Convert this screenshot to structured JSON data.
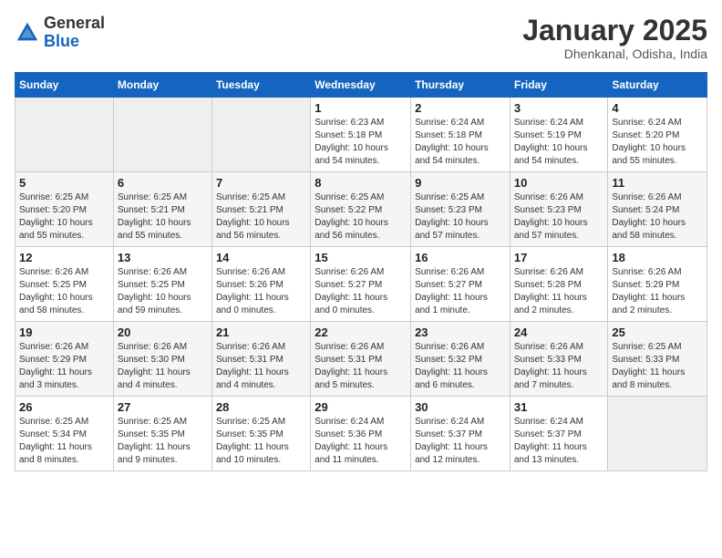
{
  "header": {
    "logo_general": "General",
    "logo_blue": "Blue",
    "month_title": "January 2025",
    "location": "Dhenkanal, Odisha, India"
  },
  "weekdays": [
    "Sunday",
    "Monday",
    "Tuesday",
    "Wednesday",
    "Thursday",
    "Friday",
    "Saturday"
  ],
  "weeks": [
    [
      {
        "day": "",
        "info": ""
      },
      {
        "day": "",
        "info": ""
      },
      {
        "day": "",
        "info": ""
      },
      {
        "day": "1",
        "info": "Sunrise: 6:23 AM\nSunset: 5:18 PM\nDaylight: 10 hours\nand 54 minutes."
      },
      {
        "day": "2",
        "info": "Sunrise: 6:24 AM\nSunset: 5:18 PM\nDaylight: 10 hours\nand 54 minutes."
      },
      {
        "day": "3",
        "info": "Sunrise: 6:24 AM\nSunset: 5:19 PM\nDaylight: 10 hours\nand 54 minutes."
      },
      {
        "day": "4",
        "info": "Sunrise: 6:24 AM\nSunset: 5:20 PM\nDaylight: 10 hours\nand 55 minutes."
      }
    ],
    [
      {
        "day": "5",
        "info": "Sunrise: 6:25 AM\nSunset: 5:20 PM\nDaylight: 10 hours\nand 55 minutes."
      },
      {
        "day": "6",
        "info": "Sunrise: 6:25 AM\nSunset: 5:21 PM\nDaylight: 10 hours\nand 55 minutes."
      },
      {
        "day": "7",
        "info": "Sunrise: 6:25 AM\nSunset: 5:21 PM\nDaylight: 10 hours\nand 56 minutes."
      },
      {
        "day": "8",
        "info": "Sunrise: 6:25 AM\nSunset: 5:22 PM\nDaylight: 10 hours\nand 56 minutes."
      },
      {
        "day": "9",
        "info": "Sunrise: 6:25 AM\nSunset: 5:23 PM\nDaylight: 10 hours\nand 57 minutes."
      },
      {
        "day": "10",
        "info": "Sunrise: 6:26 AM\nSunset: 5:23 PM\nDaylight: 10 hours\nand 57 minutes."
      },
      {
        "day": "11",
        "info": "Sunrise: 6:26 AM\nSunset: 5:24 PM\nDaylight: 10 hours\nand 58 minutes."
      }
    ],
    [
      {
        "day": "12",
        "info": "Sunrise: 6:26 AM\nSunset: 5:25 PM\nDaylight: 10 hours\nand 58 minutes."
      },
      {
        "day": "13",
        "info": "Sunrise: 6:26 AM\nSunset: 5:25 PM\nDaylight: 10 hours\nand 59 minutes."
      },
      {
        "day": "14",
        "info": "Sunrise: 6:26 AM\nSunset: 5:26 PM\nDaylight: 11 hours\nand 0 minutes."
      },
      {
        "day": "15",
        "info": "Sunrise: 6:26 AM\nSunset: 5:27 PM\nDaylight: 11 hours\nand 0 minutes."
      },
      {
        "day": "16",
        "info": "Sunrise: 6:26 AM\nSunset: 5:27 PM\nDaylight: 11 hours\nand 1 minute."
      },
      {
        "day": "17",
        "info": "Sunrise: 6:26 AM\nSunset: 5:28 PM\nDaylight: 11 hours\nand 2 minutes."
      },
      {
        "day": "18",
        "info": "Sunrise: 6:26 AM\nSunset: 5:29 PM\nDaylight: 11 hours\nand 2 minutes."
      }
    ],
    [
      {
        "day": "19",
        "info": "Sunrise: 6:26 AM\nSunset: 5:29 PM\nDaylight: 11 hours\nand 3 minutes."
      },
      {
        "day": "20",
        "info": "Sunrise: 6:26 AM\nSunset: 5:30 PM\nDaylight: 11 hours\nand 4 minutes."
      },
      {
        "day": "21",
        "info": "Sunrise: 6:26 AM\nSunset: 5:31 PM\nDaylight: 11 hours\nand 4 minutes."
      },
      {
        "day": "22",
        "info": "Sunrise: 6:26 AM\nSunset: 5:31 PM\nDaylight: 11 hours\nand 5 minutes."
      },
      {
        "day": "23",
        "info": "Sunrise: 6:26 AM\nSunset: 5:32 PM\nDaylight: 11 hours\nand 6 minutes."
      },
      {
        "day": "24",
        "info": "Sunrise: 6:26 AM\nSunset: 5:33 PM\nDaylight: 11 hours\nand 7 minutes."
      },
      {
        "day": "25",
        "info": "Sunrise: 6:25 AM\nSunset: 5:33 PM\nDaylight: 11 hours\nand 8 minutes."
      }
    ],
    [
      {
        "day": "26",
        "info": "Sunrise: 6:25 AM\nSunset: 5:34 PM\nDaylight: 11 hours\nand 8 minutes."
      },
      {
        "day": "27",
        "info": "Sunrise: 6:25 AM\nSunset: 5:35 PM\nDaylight: 11 hours\nand 9 minutes."
      },
      {
        "day": "28",
        "info": "Sunrise: 6:25 AM\nSunset: 5:35 PM\nDaylight: 11 hours\nand 10 minutes."
      },
      {
        "day": "29",
        "info": "Sunrise: 6:24 AM\nSunset: 5:36 PM\nDaylight: 11 hours\nand 11 minutes."
      },
      {
        "day": "30",
        "info": "Sunrise: 6:24 AM\nSunset: 5:37 PM\nDaylight: 11 hours\nand 12 minutes."
      },
      {
        "day": "31",
        "info": "Sunrise: 6:24 AM\nSunset: 5:37 PM\nDaylight: 11 hours\nand 13 minutes."
      },
      {
        "day": "",
        "info": ""
      }
    ]
  ]
}
